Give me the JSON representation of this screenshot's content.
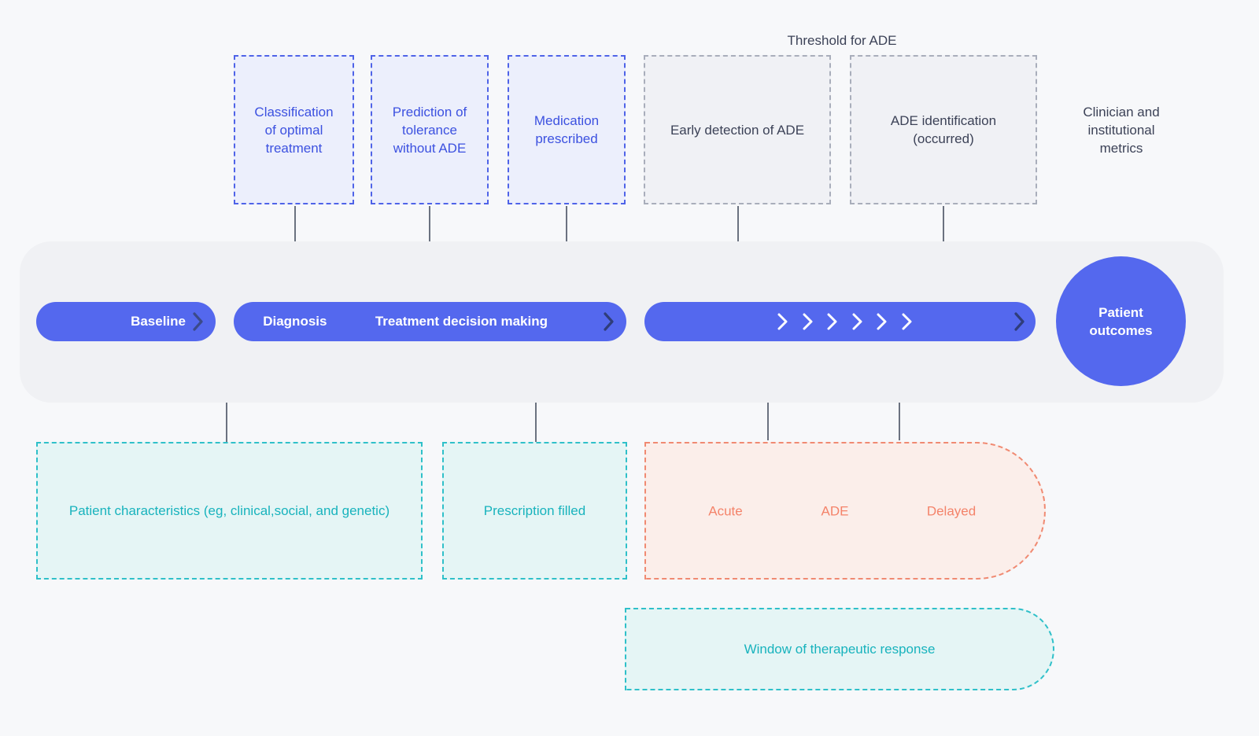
{
  "diagram": {
    "title_note": "Threshold for ADE",
    "side_note": "Clinician and\ninstitutional\nmetrics",
    "colors": {
      "background": "#f7f8fa",
      "blue_accent": "#5468ee",
      "blue_dashed_border": "#4f63e8",
      "blue_dashed_fill": "#eceefc",
      "blue_text": "#3c51e0",
      "grey_dashed_border": "#a9aebb",
      "grey_dashed_fill": "#f0f1f5",
      "grey_text": "#3c4257",
      "teal_border": "#2fc0c9",
      "teal_fill": "#e5f5f5",
      "teal_text": "#18b3bd",
      "pink_border": "#f08a72",
      "pink_fill": "#fbeeea",
      "pink_text": "#f4836a",
      "track_fill": "#f0f1f4",
      "connector": "#6b7280"
    },
    "top_row": [
      {
        "id": "classification-of-optimal-treatment",
        "label": "Classification\nof optimal\ntreatment",
        "style": "blue"
      },
      {
        "id": "prediction-of-tolerance-without-ade",
        "label": "Prediction of\ntolerance\nwithout ADE",
        "style": "blue"
      },
      {
        "id": "medication-prescribed",
        "label": "Medication\nprescribed",
        "style": "blue"
      },
      {
        "id": "early-detection-of-ade",
        "label": "Early detection of ADE",
        "style": "grey"
      },
      {
        "id": "ade-identification-occurred",
        "label": "ADE identification\n(occurred)",
        "style": "grey"
      }
    ],
    "timeline": {
      "bars": [
        {
          "id": "baseline-bar",
          "labels": [
            "Baseline"
          ]
        },
        {
          "id": "diagnosis-treatment-bar",
          "labels": [
            "Diagnosis",
            "Treatment decision making"
          ]
        },
        {
          "id": "ade-progression-bar",
          "labels": [],
          "inner_chevrons": 6
        }
      ],
      "outcome": {
        "id": "patient-outcomes",
        "label": "Patient\noutcomes"
      }
    },
    "bottom_row": [
      {
        "id": "patient-characteristics",
        "label": "Patient characteristics (eg, clinical,social, and genetic)",
        "style": "teal"
      },
      {
        "id": "prescription-filled",
        "label": "Prescription filled",
        "style": "teal"
      },
      {
        "id": "ade-phases",
        "label": "",
        "style": "pink",
        "phases": [
          "Acute",
          "ADE",
          "Delayed"
        ]
      }
    ],
    "footer_box": {
      "id": "window-of-therapeutic-response",
      "label": "Window of therapeutic response",
      "style": "teal"
    }
  }
}
